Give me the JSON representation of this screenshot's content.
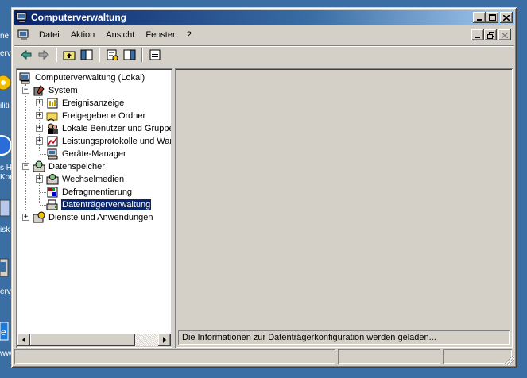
{
  "window": {
    "title": "Computerverwaltung"
  },
  "menu": {
    "items": [
      {
        "label": "Datei"
      },
      {
        "label": "Aktion"
      },
      {
        "label": "Ansicht"
      },
      {
        "label": "Fenster"
      },
      {
        "label": "?"
      }
    ]
  },
  "toolbar": {
    "buttons": [
      "back-arrow-icon",
      "forward-arrow-icon",
      "up-folder-icon",
      "show-hide-console-tree-icon",
      "properties-icon",
      "help-topics-icon",
      "export-list-icon"
    ]
  },
  "tree": {
    "root": "Computerverwaltung (Lokal)",
    "system": "System",
    "system_children": [
      "Ereignisanzeige",
      "Freigegebene Ordner",
      "Lokale Benutzer und Gruppen",
      "Leistungsprotokolle und Warnungen",
      "Geräte-Manager"
    ],
    "storage": "Datenspeicher",
    "storage_children": [
      "Wechselmedien",
      "Defragmentierung",
      "Datenträgerverwaltung"
    ],
    "services": "Dienste und Anwendungen",
    "selected": "Datenträgerverwaltung"
  },
  "details": {
    "info_text": "Die Informationen zur Datenträgerkonfiguration werden geladen..."
  },
  "desktop": {
    "fragments": [
      "ne",
      "erv",
      "iliti",
      "s H",
      "Kon",
      "isk",
      "erv",
      "ww"
    ]
  },
  "colors": {
    "desktop": "#3a6ea5",
    "titlebar_start": "#0a246a",
    "titlebar_end": "#a6caf0",
    "face": "#d4d0c8",
    "selection": "#0a246a"
  }
}
